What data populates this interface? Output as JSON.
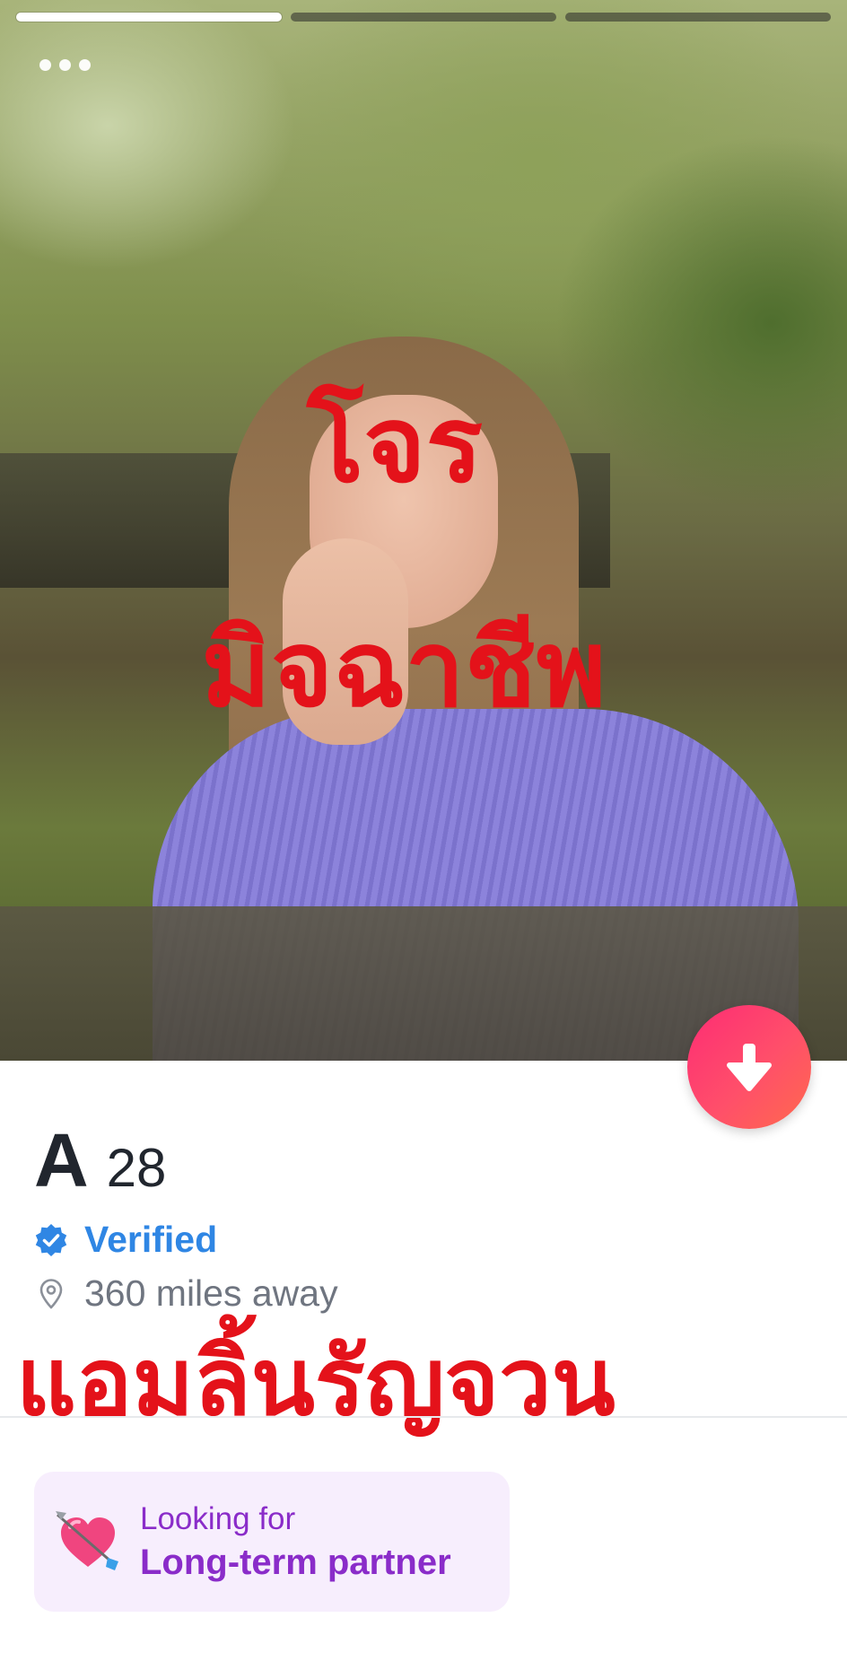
{
  "story": {
    "photo_count": 3,
    "active_photo_index": 0
  },
  "overlay": {
    "line1": "โจร",
    "line2": "มิจฉาชีพ",
    "line3": "แอมลิ้นรัญจวน",
    "color": "#e4121a"
  },
  "profile": {
    "name": "A",
    "age": "28",
    "verified_label": "Verified",
    "distance": "360 miles away"
  },
  "looking_for": {
    "label": "Looking for",
    "value": "Long-term partner"
  },
  "icons": {
    "menu": "more-dots-icon",
    "collapse": "arrow-down-icon",
    "verified": "verified-badge-icon",
    "location": "location-pin-icon",
    "looking_for": "heart-with-arrow-icon"
  },
  "colors": {
    "accent_gradient_start": "#fd2c74",
    "accent_gradient_end": "#ff6a4d",
    "verified_blue": "#2f86e4",
    "looking_purple": "#8a2cc9",
    "looking_card_bg": "#f7eefd"
  }
}
